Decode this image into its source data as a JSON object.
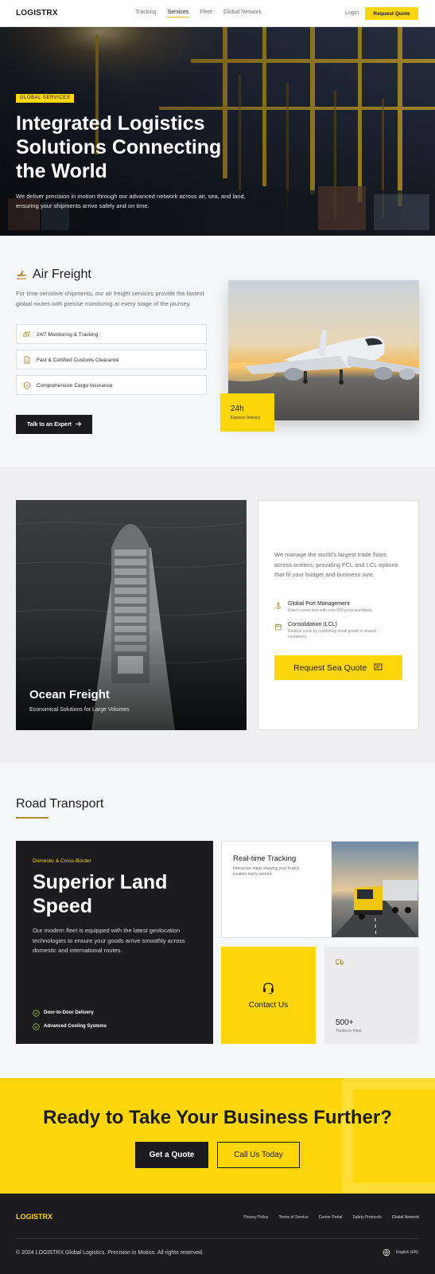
{
  "nav": {
    "brand": "LOGISTRX",
    "links": [
      "Tracking",
      "Services",
      "Fleet",
      "Global Network"
    ],
    "active": "Services",
    "login": "Login",
    "cta": "Request Quote"
  },
  "hero": {
    "badge": "GLOBAL SERVICES",
    "title": "Integrated Logistics Solutions Connecting the World",
    "subtitle": "We deliver precision in motion through our advanced network across air, sea, and land, ensuring your shipments arrive safely and on time."
  },
  "air": {
    "icon": "airplane-icon",
    "title": "Air Freight",
    "description": "For time-sensitive shipments, our air freight services provide the fastest global routes with precise monitoring at every stage of the journey.",
    "features": [
      {
        "icon": "chart-icon",
        "label": "24/7 Monitoring & Tracking"
      },
      {
        "icon": "document-icon",
        "label": "Fast & Certified Customs Clearance"
      },
      {
        "icon": "shield-icon",
        "label": "Comprehensive Cargo Insurance"
      }
    ],
    "button": "Talk to an Expert",
    "badge_value": "24h",
    "badge_label": "Express Delivery"
  },
  "ocean": {
    "title": "Ocean Freight",
    "subtitle": "Economical Solutions for Large Volumes",
    "description": "We manage the world's largest trade flows across oceans, providing FCL and LCL options that fit your budget and business size.",
    "items": [
      {
        "icon": "anchor-icon",
        "title": "Global Port Management",
        "desc": "Direct connection with over 500 ports worldwide."
      },
      {
        "icon": "box-icon",
        "title": "Consolidation (LCL)",
        "desc": "Reduce costs by combining small goods in shared containers."
      }
    ],
    "button": "Request Sea Quote"
  },
  "road": {
    "title": "Road Transport",
    "tag": "Domestic & Cross-Border",
    "headline": "Superior Land Speed",
    "description": "Our modern fleet is equipped with the latest geolocation technologies to ensure your goods arrive smoothly across domestic and international routes.",
    "features": [
      "Door-to-Door Delivery",
      "Advanced Cooling Systems"
    ],
    "tracking_title": "Real-time Tracking",
    "tracking_desc": "Interactive maps showing your truck's location every second.",
    "contact": "Contact Us",
    "fleet_count": "500+",
    "fleet_label": "Trucks in Fleet"
  },
  "cta": {
    "title": "Ready to Take Your Business Further?",
    "primary": "Get a Quote",
    "secondary": "Call Us Today"
  },
  "footer": {
    "brand": "LOGISTRX",
    "links": [
      "Privacy Policy",
      "Terms of Service",
      "Carrier Portal",
      "Safety Protocols",
      "Global Network"
    ],
    "copyright": "© 2024 LOGISTRX Global Logistics. Precision in Motion. All rights reserved.",
    "language": "English (EN)"
  },
  "colors": {
    "accent": "#ffd60a",
    "dark": "#1c1c1e",
    "muted": "#6a6b70"
  }
}
